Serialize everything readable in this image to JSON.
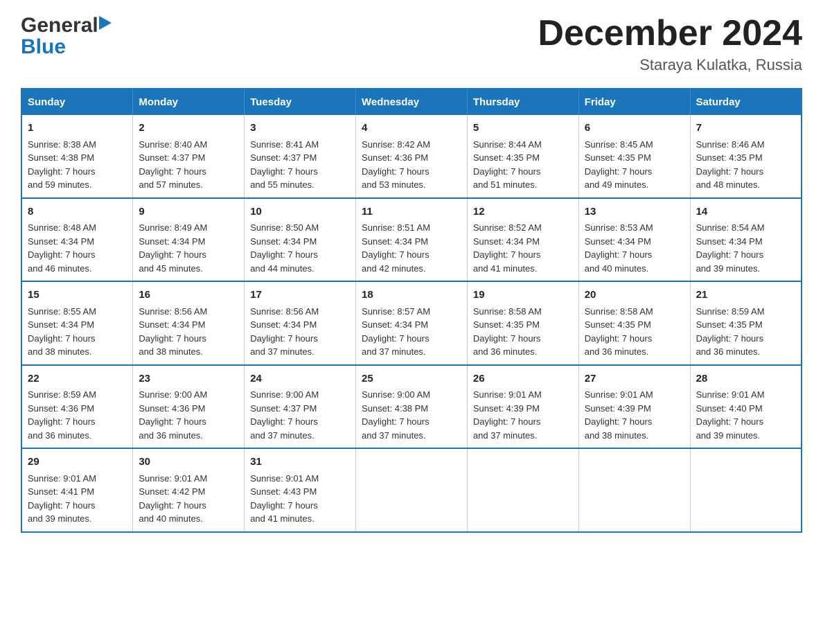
{
  "header": {
    "logo_general": "General",
    "logo_blue": "Blue",
    "month_title": "December 2024",
    "subtitle": "Staraya Kulatka, Russia"
  },
  "calendar": {
    "days_of_week": [
      "Sunday",
      "Monday",
      "Tuesday",
      "Wednesday",
      "Thursday",
      "Friday",
      "Saturday"
    ],
    "weeks": [
      [
        {
          "day": "1",
          "sunrise": "Sunrise: 8:38 AM",
          "sunset": "Sunset: 4:38 PM",
          "daylight": "Daylight: 7 hours",
          "daylight2": "and 59 minutes."
        },
        {
          "day": "2",
          "sunrise": "Sunrise: 8:40 AM",
          "sunset": "Sunset: 4:37 PM",
          "daylight": "Daylight: 7 hours",
          "daylight2": "and 57 minutes."
        },
        {
          "day": "3",
          "sunrise": "Sunrise: 8:41 AM",
          "sunset": "Sunset: 4:37 PM",
          "daylight": "Daylight: 7 hours",
          "daylight2": "and 55 minutes."
        },
        {
          "day": "4",
          "sunrise": "Sunrise: 8:42 AM",
          "sunset": "Sunset: 4:36 PM",
          "daylight": "Daylight: 7 hours",
          "daylight2": "and 53 minutes."
        },
        {
          "day": "5",
          "sunrise": "Sunrise: 8:44 AM",
          "sunset": "Sunset: 4:35 PM",
          "daylight": "Daylight: 7 hours",
          "daylight2": "and 51 minutes."
        },
        {
          "day": "6",
          "sunrise": "Sunrise: 8:45 AM",
          "sunset": "Sunset: 4:35 PM",
          "daylight": "Daylight: 7 hours",
          "daylight2": "and 49 minutes."
        },
        {
          "day": "7",
          "sunrise": "Sunrise: 8:46 AM",
          "sunset": "Sunset: 4:35 PM",
          "daylight": "Daylight: 7 hours",
          "daylight2": "and 48 minutes."
        }
      ],
      [
        {
          "day": "8",
          "sunrise": "Sunrise: 8:48 AM",
          "sunset": "Sunset: 4:34 PM",
          "daylight": "Daylight: 7 hours",
          "daylight2": "and 46 minutes."
        },
        {
          "day": "9",
          "sunrise": "Sunrise: 8:49 AM",
          "sunset": "Sunset: 4:34 PM",
          "daylight": "Daylight: 7 hours",
          "daylight2": "and 45 minutes."
        },
        {
          "day": "10",
          "sunrise": "Sunrise: 8:50 AM",
          "sunset": "Sunset: 4:34 PM",
          "daylight": "Daylight: 7 hours",
          "daylight2": "and 44 minutes."
        },
        {
          "day": "11",
          "sunrise": "Sunrise: 8:51 AM",
          "sunset": "Sunset: 4:34 PM",
          "daylight": "Daylight: 7 hours",
          "daylight2": "and 42 minutes."
        },
        {
          "day": "12",
          "sunrise": "Sunrise: 8:52 AM",
          "sunset": "Sunset: 4:34 PM",
          "daylight": "Daylight: 7 hours",
          "daylight2": "and 41 minutes."
        },
        {
          "day": "13",
          "sunrise": "Sunrise: 8:53 AM",
          "sunset": "Sunset: 4:34 PM",
          "daylight": "Daylight: 7 hours",
          "daylight2": "and 40 minutes."
        },
        {
          "day": "14",
          "sunrise": "Sunrise: 8:54 AM",
          "sunset": "Sunset: 4:34 PM",
          "daylight": "Daylight: 7 hours",
          "daylight2": "and 39 minutes."
        }
      ],
      [
        {
          "day": "15",
          "sunrise": "Sunrise: 8:55 AM",
          "sunset": "Sunset: 4:34 PM",
          "daylight": "Daylight: 7 hours",
          "daylight2": "and 38 minutes."
        },
        {
          "day": "16",
          "sunrise": "Sunrise: 8:56 AM",
          "sunset": "Sunset: 4:34 PM",
          "daylight": "Daylight: 7 hours",
          "daylight2": "and 38 minutes."
        },
        {
          "day": "17",
          "sunrise": "Sunrise: 8:56 AM",
          "sunset": "Sunset: 4:34 PM",
          "daylight": "Daylight: 7 hours",
          "daylight2": "and 37 minutes."
        },
        {
          "day": "18",
          "sunrise": "Sunrise: 8:57 AM",
          "sunset": "Sunset: 4:34 PM",
          "daylight": "Daylight: 7 hours",
          "daylight2": "and 37 minutes."
        },
        {
          "day": "19",
          "sunrise": "Sunrise: 8:58 AM",
          "sunset": "Sunset: 4:35 PM",
          "daylight": "Daylight: 7 hours",
          "daylight2": "and 36 minutes."
        },
        {
          "day": "20",
          "sunrise": "Sunrise: 8:58 AM",
          "sunset": "Sunset: 4:35 PM",
          "daylight": "Daylight: 7 hours",
          "daylight2": "and 36 minutes."
        },
        {
          "day": "21",
          "sunrise": "Sunrise: 8:59 AM",
          "sunset": "Sunset: 4:35 PM",
          "daylight": "Daylight: 7 hours",
          "daylight2": "and 36 minutes."
        }
      ],
      [
        {
          "day": "22",
          "sunrise": "Sunrise: 8:59 AM",
          "sunset": "Sunset: 4:36 PM",
          "daylight": "Daylight: 7 hours",
          "daylight2": "and 36 minutes."
        },
        {
          "day": "23",
          "sunrise": "Sunrise: 9:00 AM",
          "sunset": "Sunset: 4:36 PM",
          "daylight": "Daylight: 7 hours",
          "daylight2": "and 36 minutes."
        },
        {
          "day": "24",
          "sunrise": "Sunrise: 9:00 AM",
          "sunset": "Sunset: 4:37 PM",
          "daylight": "Daylight: 7 hours",
          "daylight2": "and 37 minutes."
        },
        {
          "day": "25",
          "sunrise": "Sunrise: 9:00 AM",
          "sunset": "Sunset: 4:38 PM",
          "daylight": "Daylight: 7 hours",
          "daylight2": "and 37 minutes."
        },
        {
          "day": "26",
          "sunrise": "Sunrise: 9:01 AM",
          "sunset": "Sunset: 4:39 PM",
          "daylight": "Daylight: 7 hours",
          "daylight2": "and 37 minutes."
        },
        {
          "day": "27",
          "sunrise": "Sunrise: 9:01 AM",
          "sunset": "Sunset: 4:39 PM",
          "daylight": "Daylight: 7 hours",
          "daylight2": "and 38 minutes."
        },
        {
          "day": "28",
          "sunrise": "Sunrise: 9:01 AM",
          "sunset": "Sunset: 4:40 PM",
          "daylight": "Daylight: 7 hours",
          "daylight2": "and 39 minutes."
        }
      ],
      [
        {
          "day": "29",
          "sunrise": "Sunrise: 9:01 AM",
          "sunset": "Sunset: 4:41 PM",
          "daylight": "Daylight: 7 hours",
          "daylight2": "and 39 minutes."
        },
        {
          "day": "30",
          "sunrise": "Sunrise: 9:01 AM",
          "sunset": "Sunset: 4:42 PM",
          "daylight": "Daylight: 7 hours",
          "daylight2": "and 40 minutes."
        },
        {
          "day": "31",
          "sunrise": "Sunrise: 9:01 AM",
          "sunset": "Sunset: 4:43 PM",
          "daylight": "Daylight: 7 hours",
          "daylight2": "and 41 minutes."
        },
        null,
        null,
        null,
        null
      ]
    ]
  }
}
